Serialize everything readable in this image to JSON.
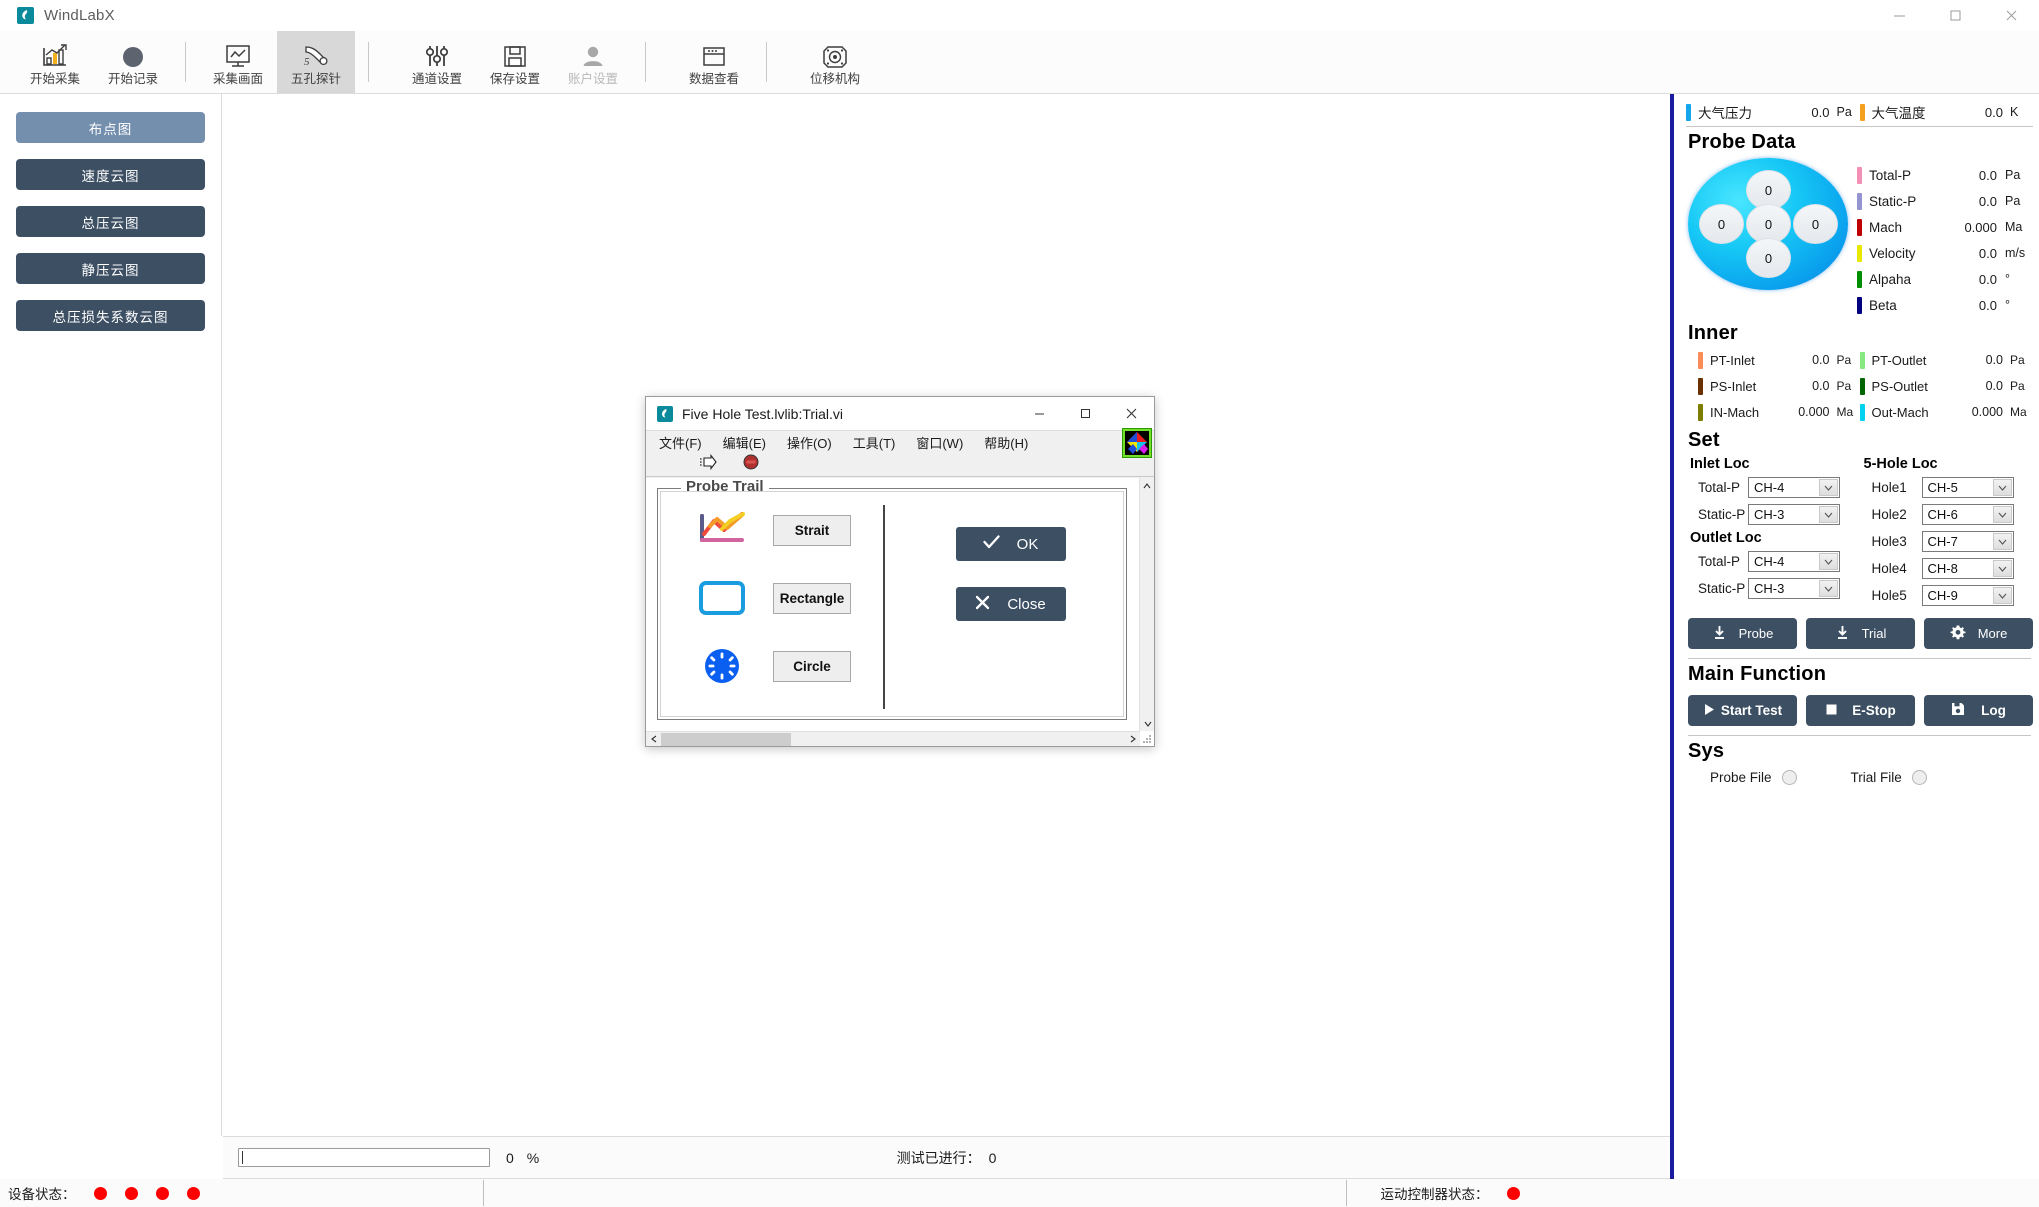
{
  "window": {
    "title": "WindLabX",
    "controls": {
      "minimize": "minimize-icon",
      "maximize": "maximize-icon",
      "close": "close-icon"
    }
  },
  "toolbar": {
    "items": [
      {
        "label": "开始采集",
        "icon": "bar-chart-icon",
        "state": "normal"
      },
      {
        "label": "开始记录",
        "icon": "record-circle-icon",
        "state": "normal"
      },
      {
        "label": "采集画面",
        "icon": "monitor-chart-icon",
        "state": "normal"
      },
      {
        "label": "五孔探针",
        "icon": "five-hole-probe-icon",
        "state": "active"
      },
      {
        "label": "通道设置",
        "icon": "sliders-icon",
        "state": "normal"
      },
      {
        "label": "保存设置",
        "icon": "floppy-save-icon",
        "state": "normal"
      },
      {
        "label": "账户设置",
        "icon": "user-account-icon",
        "state": "disabled"
      },
      {
        "label": "数据查看",
        "icon": "window-table-icon",
        "state": "normal"
      },
      {
        "label": "位移机构",
        "icon": "motor-stage-icon",
        "state": "normal"
      }
    ]
  },
  "sidebar": {
    "items": [
      {
        "label": "布点图",
        "selected": true
      },
      {
        "label": "速度云图",
        "selected": false
      },
      {
        "label": "总压云图",
        "selected": false
      },
      {
        "label": "静压云图",
        "selected": false
      },
      {
        "label": "总压损失系数云图",
        "selected": false
      }
    ]
  },
  "progress": {
    "value": "0",
    "unit": "%",
    "counter_label": "测试已进行：",
    "counter_value": "0"
  },
  "statusbar": {
    "device_label": "设备状态：",
    "device_leds": 4,
    "motion_label": "运动控制器状态：",
    "motion_leds": 1,
    "led_color": "#fe0000"
  },
  "right_panel": {
    "atmosphere": [
      {
        "label": "大气压力",
        "value": "0.0",
        "unit": "Pa",
        "color": "#13a6ea"
      },
      {
        "label": "大气温度",
        "value": "0.0",
        "unit": "K",
        "color": "#f5a11e"
      }
    ],
    "probe_data": {
      "heading": "Probe Data",
      "holes": [
        "0",
        "0",
        "0",
        "0",
        "0"
      ],
      "values": [
        {
          "label": "Total-P",
          "value": "0.0",
          "unit": "Pa",
          "color": "#f48fb6"
        },
        {
          "label": "Static-P",
          "value": "0.0",
          "unit": "Pa",
          "color": "#9394d0"
        },
        {
          "label": "Mach",
          "value": "0.000",
          "unit": "Ma",
          "color": "#c00000"
        },
        {
          "label": "Velocity",
          "value": "0.0",
          "unit": "m/s",
          "color": "#e8e800"
        },
        {
          "label": "Alpaha",
          "value": "0.0",
          "unit": "°",
          "color": "#008f00"
        },
        {
          "label": "Beta",
          "value": "0.0",
          "unit": "°",
          "color": "#000080"
        }
      ]
    },
    "inner": {
      "heading": "Inner",
      "left": [
        {
          "label": "PT-Inlet",
          "value": "0.0",
          "unit": "Pa",
          "color": "#fa8c58"
        },
        {
          "label": "PS-Inlet",
          "value": "0.0",
          "unit": "Pa",
          "color": "#6b3000"
        },
        {
          "label": "IN-Mach",
          "value": "0.000",
          "unit": "Ma",
          "color": "#7d7d00"
        }
      ],
      "right": [
        {
          "label": "PT-Outlet",
          "value": "0.0",
          "unit": "Pa",
          "color": "#86e87f"
        },
        {
          "label": "PS-Outlet",
          "value": "0.0",
          "unit": "Pa",
          "color": "#006400"
        },
        {
          "label": "Out-Mach",
          "value": "0.000",
          "unit": "Ma",
          "color": "#00d2f0"
        }
      ]
    },
    "set": {
      "heading": "Set",
      "inlet_loc": {
        "title": "Inlet Loc",
        "rows": [
          {
            "label": "Total-P",
            "value": "CH-4"
          },
          {
            "label": "Static-P",
            "value": "CH-3"
          }
        ]
      },
      "outlet_loc": {
        "title": "Outlet Loc",
        "rows": [
          {
            "label": "Total-P",
            "value": "CH-4"
          },
          {
            "label": "Static-P",
            "value": "CH-3"
          }
        ]
      },
      "five_hole_loc": {
        "title": "5-Hole Loc",
        "rows": [
          {
            "label": "Hole1",
            "value": "CH-5"
          },
          {
            "label": "Hole2",
            "value": "CH-6"
          },
          {
            "label": "Hole3",
            "value": "CH-7"
          },
          {
            "label": "Hole4",
            "value": "CH-8"
          },
          {
            "label": "Hole5",
            "value": "CH-9"
          }
        ]
      },
      "buttons": [
        {
          "label": "Probe",
          "icon": "download-icon"
        },
        {
          "label": "Trial",
          "icon": "download-icon"
        },
        {
          "label": "More",
          "icon": "gear-icon"
        }
      ]
    },
    "main_function": {
      "heading": "Main Function",
      "buttons": [
        {
          "label": "Start Test",
          "icon": "play-icon"
        },
        {
          "label": "E-Stop",
          "icon": "stop-square-icon"
        },
        {
          "label": "Log",
          "icon": "floppy-save-icon"
        }
      ]
    },
    "sys": {
      "heading": "Sys",
      "indicators": [
        {
          "label": "Probe File",
          "on": false
        },
        {
          "label": "Trial File",
          "on": false
        }
      ]
    }
  },
  "dialog": {
    "title": "Five Hole Test.lvlib:Trial.vi",
    "menu": [
      "文件(F)",
      "编辑(E)",
      "操作(O)",
      "工具(T)",
      "窗口(W)",
      "帮助(H)"
    ],
    "run_buttons": [
      "run-arrow-icon",
      "abort-stop-icon"
    ],
    "group_title": "Probe Trail",
    "options": [
      {
        "label": "Strait",
        "icon": "line-chart-icon"
      },
      {
        "label": "Rectangle",
        "icon": "rectangle-outline-icon"
      },
      {
        "label": "Circle",
        "icon": "circle-dashed-icon"
      }
    ],
    "actions": [
      {
        "label": "OK",
        "icon": "check-icon"
      },
      {
        "label": "Close",
        "icon": "x-icon"
      }
    ]
  }
}
